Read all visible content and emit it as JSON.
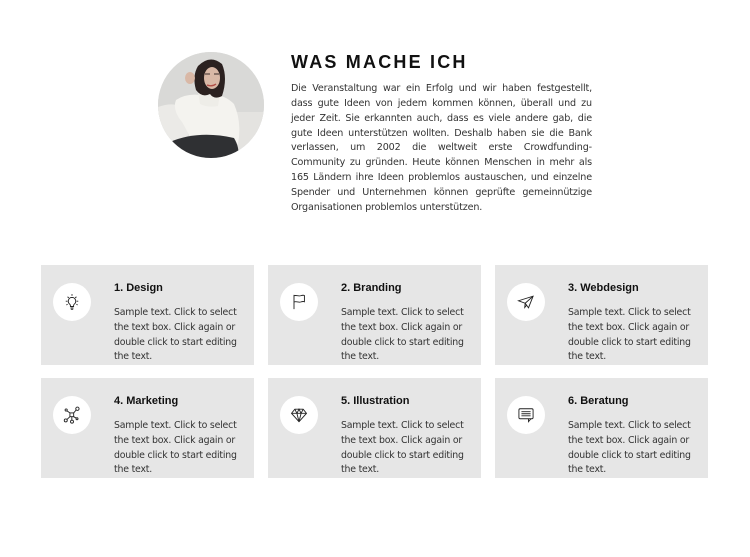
{
  "about": {
    "title": "WAS MACHE ICH",
    "text": "Die Veranstaltung war ein Erfolg und wir haben festgestellt, dass gute Ideen von jedem kommen können, überall und zu jeder Zeit. Sie erkannten auch, dass es viele andere gab, die gute Ideen unterstützen wollten. Deshalb haben sie die Bank verlassen, um 2002 die weltweit erste Crowdfunding-Community zu gründen. Heute können Menschen in mehr als 165 Ländern ihre Ideen problemlos austauschen, und einzelne Spender und Unternehmen können geprüfte gemeinnützige Organisationen problemlos unterstützen.",
    "photo": "woman-in-white-sweater-portrait"
  },
  "services": [
    {
      "title": "1. Design",
      "icon": "lightbulb-icon",
      "text": "Sample text. Click to select the text box. Click again or double click to start editing the text."
    },
    {
      "title": "2. Branding",
      "icon": "flag-icon",
      "text": "Sample text. Click to select the text box. Click again or double click to start editing the text."
    },
    {
      "title": "3. Webdesign",
      "icon": "paper-plane-icon",
      "text": "Sample text. Click to select the text box. Click again or double click to start editing the text."
    },
    {
      "title": "4. Marketing",
      "icon": "network-icon",
      "text": "Sample text. Click to select the text box. Click again or double click to start editing the text."
    },
    {
      "title": "5. Illustration",
      "icon": "diamond-icon",
      "text": "Sample text. Click to select the text box. Click again or double click to start editing the text."
    },
    {
      "title": "6. Beratung",
      "icon": "chat-bubble-icon",
      "text": "Sample text. Click to select the text box. Click again or double click to start editing the text."
    }
  ],
  "colors": {
    "card_background": "#e6e6e6",
    "icon_background": "#ffffff",
    "heading": "#111111",
    "body_text": "#333333"
  }
}
